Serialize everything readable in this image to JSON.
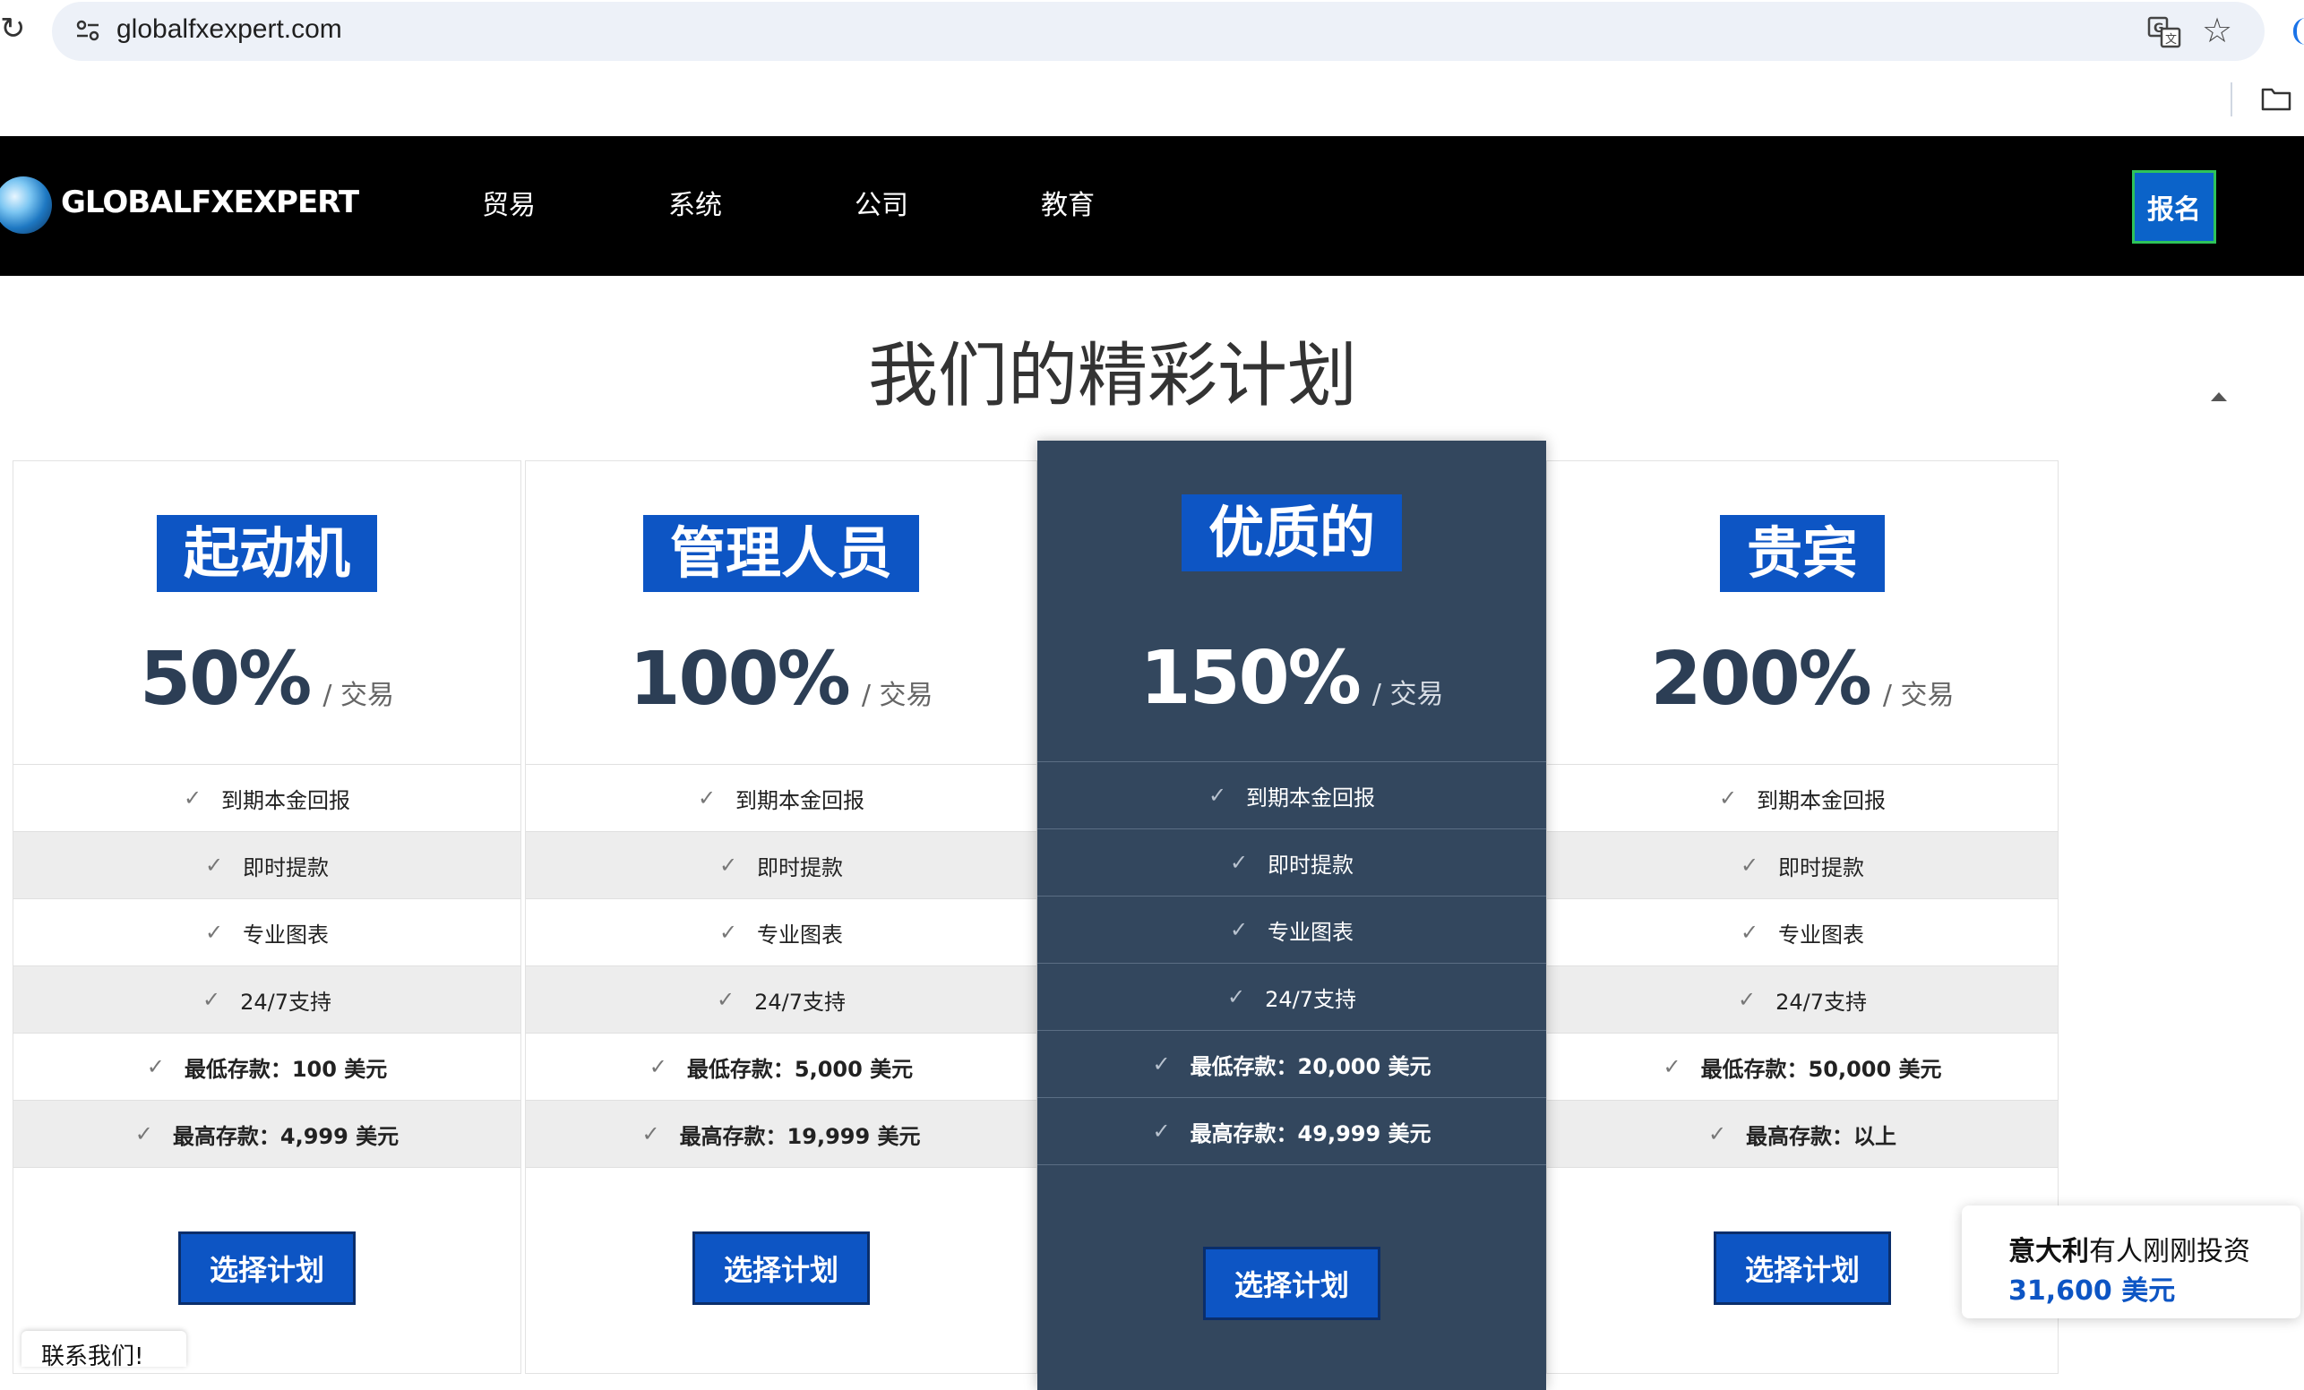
{
  "browser": {
    "url": "globalfxexpert.com"
  },
  "site": {
    "logo_text": "GLOBALFXEXPERT",
    "nav": [
      "贸易",
      "系统",
      "公司",
      "教育"
    ],
    "signup_label": "报名"
  },
  "page": {
    "title": "我们的精彩计划"
  },
  "plans": [
    {
      "name": "起动机",
      "price": "50%",
      "per": "/ 交易",
      "features": [
        "到期本金回报",
        "即时提款",
        "专业图表",
        "24/7支持",
        "最低存款：100 美元",
        "最高存款：4,999 美元"
      ],
      "button": "选择计划"
    },
    {
      "name": "管理人员",
      "price": "100%",
      "per": "/ 交易",
      "features": [
        "到期本金回报",
        "即时提款",
        "专业图表",
        "24/7支持",
        "最低存款：5,000 美元",
        "最高存款：19,999 美元"
      ],
      "button": "选择计划"
    },
    {
      "name": "优质的",
      "price": "150%",
      "per": "/ 交易",
      "features": [
        "到期本金回报",
        "即时提款",
        "专业图表",
        "24/7支持",
        "最低存款：20,000 美元",
        "最高存款：49,999 美元"
      ],
      "button": "选择计划"
    },
    {
      "name": "贵宾",
      "price": "200%",
      "per": "/ 交易",
      "features": [
        "到期本金回报",
        "即时提款",
        "专业图表",
        "24/7支持",
        "最低存款：50,000 美元",
        "最高存款：以上"
      ],
      "button": "选择计划"
    }
  ],
  "notification": {
    "country": "意大利",
    "text": "有人刚刚投资",
    "amount": "31,600 美元"
  },
  "contact": {
    "label": "联系我们!"
  },
  "colors": {
    "accent_blue": "#0d55c4",
    "featured_card": "#33475e",
    "nav_bg": "#000000"
  }
}
